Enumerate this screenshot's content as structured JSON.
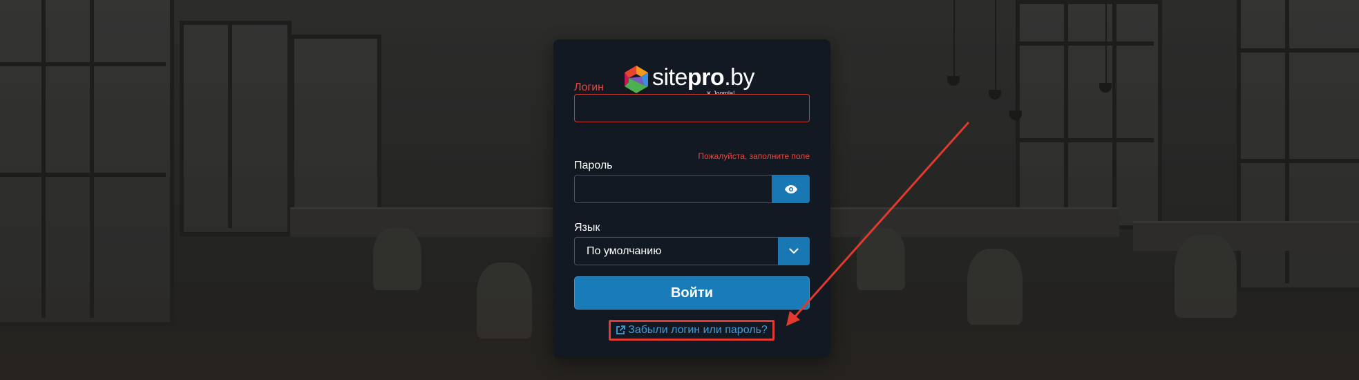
{
  "logo": {
    "brand_light": "site",
    "brand_bold": "pro",
    "brand_suffix": ".by",
    "powered_by": "Joomla!"
  },
  "form": {
    "login_label": "Логин",
    "login_value": "",
    "login_error": "Пожалуйста, заполните поле",
    "password_label": "Пароль",
    "password_value": "",
    "show_password_icon": "eye-icon",
    "language_label": "Язык",
    "language_selected": "По умолчанию",
    "submit_label": "Войти",
    "forgot_label": "Забыли логин или пароль?",
    "forgot_icon": "external-link-icon"
  },
  "colors": {
    "card_bg": "#131922",
    "accent": "#1a7bb9",
    "error": "#e5483d",
    "link": "#3f9ddb",
    "annotation": "#e23a2e"
  }
}
